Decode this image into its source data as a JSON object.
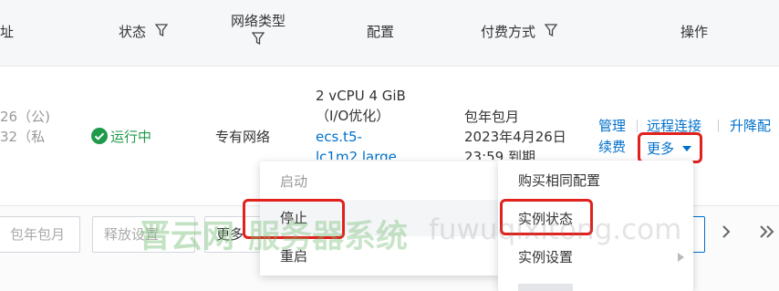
{
  "header": {
    "col_address": "址",
    "col_status": "状态",
    "col_network_line1": "网络类型",
    "col_config": "配置",
    "col_billing": "付费方式",
    "col_actions": "操作"
  },
  "row": {
    "ip_public": "26（公)",
    "ip_private": "32（私",
    "status": "运行中",
    "network": "专有网络",
    "config_spec": "2 vCPU 4 GiB",
    "config_io": "（I/O优化）",
    "config_type_line1": "ecs.t5-",
    "config_type_line2": "lc1m2.large",
    "billing_type": "包年包月",
    "billing_date": "2023年4月26日",
    "billing_expire": "23:59 到期",
    "action_manage": "管理",
    "action_remote": "远程连接",
    "action_upgrade": "升降配",
    "action_renew": "续费",
    "action_more": "更多"
  },
  "toolbar": {
    "btn_billing": "包年包月",
    "btn_release": "释放设置",
    "btn_more": "更多"
  },
  "left_menu": {
    "start": "启动",
    "stop": "停止",
    "restart": "重启"
  },
  "right_menu": {
    "buy_same": "购买相同配置",
    "instance_status": "实例状态",
    "instance_settings": "实例设置"
  },
  "watermark": {
    "brand": "晋云网",
    "site_cn": "服务器系统",
    "site_url": "fuwuqixitong.com"
  },
  "colors": {
    "link": "#0070cc",
    "running": "#1f9a4a",
    "highlight": "#e0211c"
  }
}
